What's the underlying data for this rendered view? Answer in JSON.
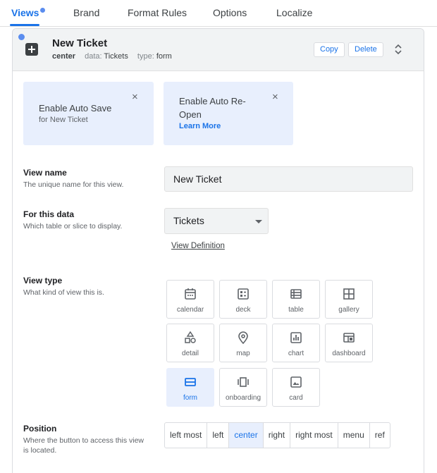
{
  "nav": {
    "tabs": [
      {
        "label": "Views"
      },
      {
        "label": "Brand"
      },
      {
        "label": "Format Rules"
      },
      {
        "label": "Options"
      },
      {
        "label": "Localize"
      }
    ]
  },
  "view": {
    "title": "New Ticket",
    "position": "center",
    "data_label": "data:",
    "data_value": "Tickets",
    "type_label": "type:",
    "type_value": "form",
    "copy_label": "Copy",
    "delete_label": "Delete"
  },
  "notices": [
    {
      "title": "Enable Auto Save",
      "sub": "for New Ticket",
      "close": "×"
    },
    {
      "title": "Enable Auto Re-Open",
      "link": "Learn More",
      "close": "×"
    }
  ],
  "view_name": {
    "label": "View name",
    "desc": "The unique name for this view.",
    "value": "New Ticket"
  },
  "for_data": {
    "label": "For this data",
    "desc": "Which table or slice to display.",
    "selected": "Tickets",
    "view_definition": "View Definition"
  },
  "view_type": {
    "label": "View type",
    "desc": "What kind of view this is.",
    "options": [
      {
        "label": "calendar",
        "icon": "calendar-icon"
      },
      {
        "label": "deck",
        "icon": "deck-icon"
      },
      {
        "label": "table",
        "icon": "table-icon"
      },
      {
        "label": "gallery",
        "icon": "gallery-icon"
      },
      {
        "label": "detail",
        "icon": "detail-icon"
      },
      {
        "label": "map",
        "icon": "map-pin-icon"
      },
      {
        "label": "chart",
        "icon": "chart-icon"
      },
      {
        "label": "dashboard",
        "icon": "dashboard-icon"
      },
      {
        "label": "form",
        "icon": "form-icon"
      },
      {
        "label": "onboarding",
        "icon": "onboarding-icon"
      },
      {
        "label": "card",
        "icon": "card-icon"
      }
    ],
    "selected": "form"
  },
  "position": {
    "label": "Position",
    "desc": "Where the button to access this view is located.",
    "options": [
      "left most",
      "left",
      "center",
      "right",
      "right most",
      "menu",
      "ref"
    ],
    "selected": "center"
  },
  "colors": {
    "accent": "#1a73e8",
    "selected_bg": "#e8effd",
    "header_bg": "#f1f3f4"
  }
}
